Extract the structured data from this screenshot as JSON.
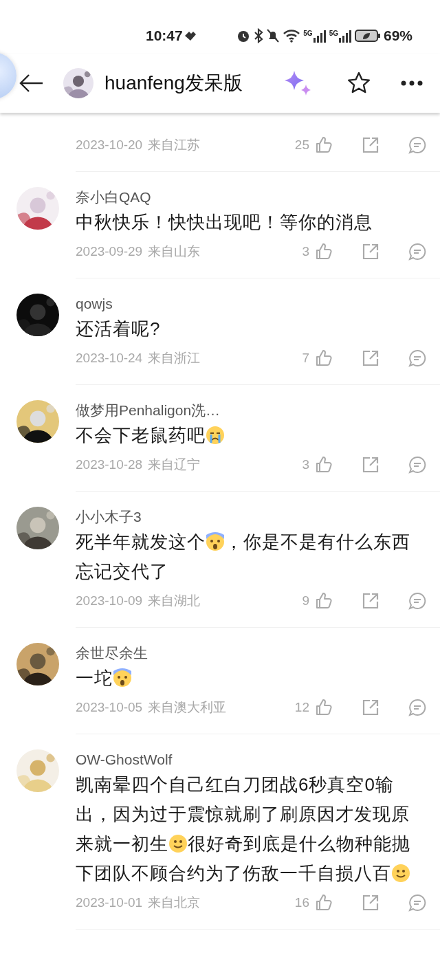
{
  "status_bar": {
    "time": "10:47",
    "network_1": "5G",
    "network_2": "5G",
    "battery": "69%"
  },
  "header": {
    "title": "huanfeng发呆版",
    "favorited": false
  },
  "comments": [
    {
      "date": "2023-10-20",
      "location": "来自江苏",
      "likes": "25"
    },
    {
      "name": "奈小白QAQ",
      "lines": [
        [
          {
            "kind": "text",
            "text": "中秋快乐！快快出现吧！等你的消息"
          }
        ]
      ],
      "date": "2023-09-29",
      "location": "来自山东",
      "likes": "3"
    },
    {
      "name": "qowjs",
      "lines": [
        [
          {
            "kind": "text",
            "text": "还活着呢?"
          }
        ]
      ],
      "date": "2023-10-24",
      "location": "来自浙江",
      "likes": "7"
    },
    {
      "name": "做梦用Penhaligon洗…",
      "lines": [
        [
          {
            "kind": "text",
            "text": "不会下老鼠药吧"
          },
          {
            "kind": "crying"
          }
        ]
      ],
      "date": "2023-10-28",
      "location": "来自辽宁",
      "likes": "3"
    },
    {
      "name": "小小木子3",
      "lines": [
        [
          {
            "kind": "text",
            "text": "死半年就发这个"
          },
          {
            "kind": "fearful"
          },
          {
            "kind": "text",
            "text": "，你是不是有什么东西"
          }
        ],
        [
          {
            "kind": "text",
            "text": "忘记交代了"
          }
        ]
      ],
      "date": "2023-10-09",
      "location": "来自湖北",
      "likes": "9"
    },
    {
      "name": "余世尽余生",
      "lines": [
        [
          {
            "kind": "text",
            "text": "一坨"
          },
          {
            "kind": "fearful"
          }
        ]
      ],
      "date": "2023-10-05",
      "location": "来自澳大利亚",
      "likes": "12"
    },
    {
      "name": "OW-GhostWolf",
      "lines": [
        [
          {
            "kind": "text",
            "text": "凯南晕四个自己红白刀团战6秒真空0输"
          }
        ],
        [
          {
            "kind": "text",
            "text": "出，因为过于震惊就刷了刷原因才发现原"
          }
        ],
        [
          {
            "kind": "text",
            "text": "来就一初生"
          },
          {
            "kind": "smile"
          },
          {
            "kind": "text",
            "text": "很好奇到底是什么物种能抛"
          }
        ],
        [
          {
            "kind": "text",
            "text": "下团队不顾合约为了伤敌一千自损八百"
          },
          {
            "kind": "smile"
          }
        ]
      ],
      "date": "2023-10-01",
      "location": "来自北京",
      "likes": "16"
    }
  ]
}
